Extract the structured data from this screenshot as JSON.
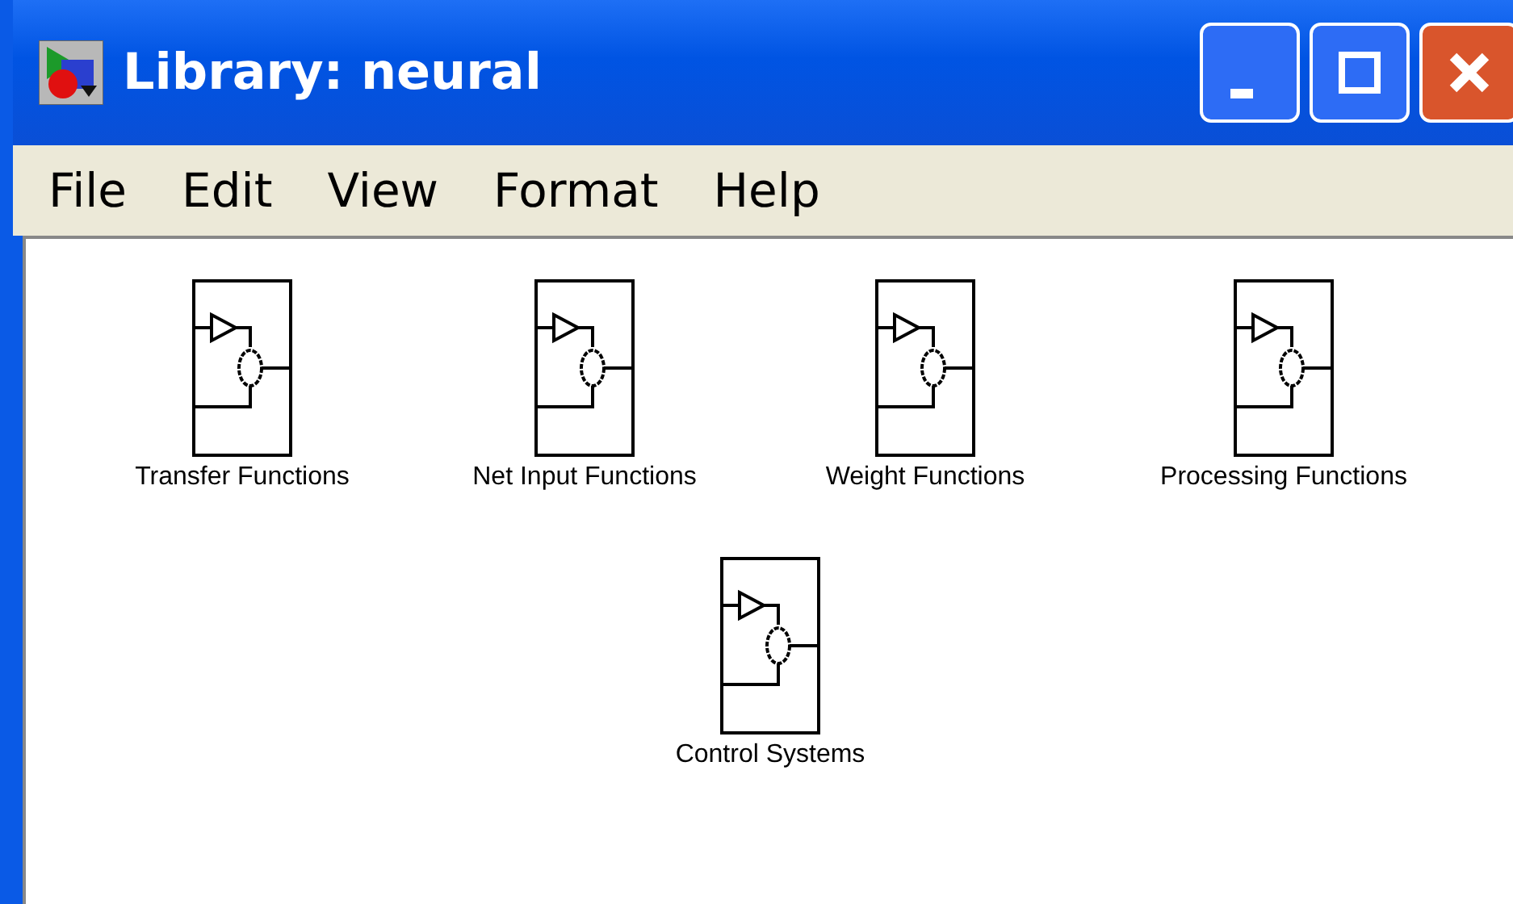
{
  "window": {
    "title": "Library: neural"
  },
  "menu": [
    "File",
    "Edit",
    "View",
    "Format",
    "Help"
  ],
  "blocks": [
    {
      "label": "Transfer Functions"
    },
    {
      "label": "Net Input Functions"
    },
    {
      "label": "Weight Functions"
    },
    {
      "label": "Processing Functions"
    },
    {
      "label": "Control Systems"
    }
  ]
}
